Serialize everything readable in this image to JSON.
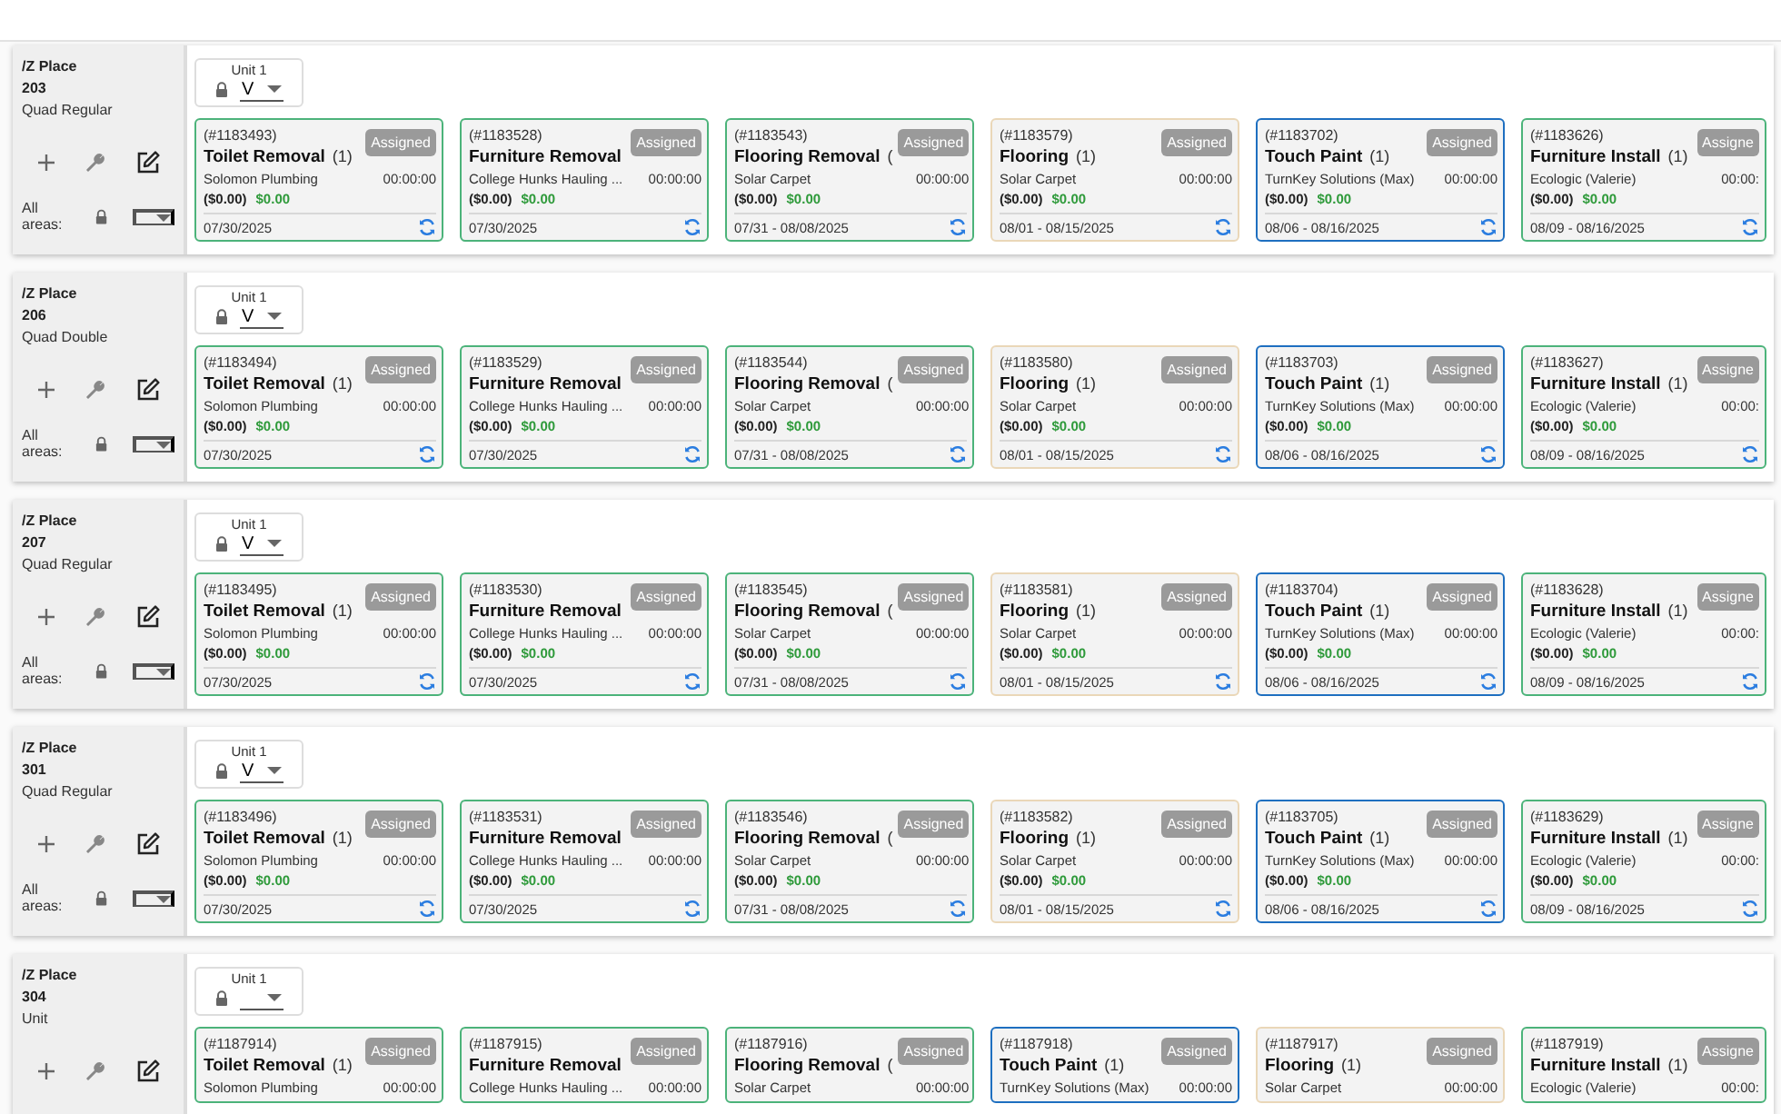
{
  "rows": [
    {
      "place": "/Z Place",
      "number": "203",
      "type": "Quad Regular",
      "all_areas_label": "All areas:",
      "unit": {
        "label": "Unit 1",
        "value": "V"
      },
      "cards": [
        {
          "id": "(#1183493)",
          "title": "Toilet Removal",
          "count": "(1)",
          "company": "Solomon Plumbing",
          "status": "Assigned",
          "timer": "00:00:00",
          "cost": "($0.00)",
          "paid": "$0.00",
          "dates": "07/30/2025",
          "color": "#4cb37a"
        },
        {
          "id": "(#1183528)",
          "title": "Furniture Removal",
          "company": "College Hunks Hauling ...",
          "status": "Assigned",
          "timer": "00:00:00",
          "cost": "($0.00)",
          "paid": "$0.00",
          "dates": "07/30/2025",
          "color": "#4cb37a"
        },
        {
          "id": "(#1183543)",
          "title": "Flooring Removal",
          "count": "(",
          "company": "Solar Carpet",
          "status": "Assigned",
          "timer": "00:00:00",
          "cost": "($0.00)",
          "paid": "$0.00",
          "dates": "07/31 - 08/08/2025",
          "color": "#4cb37a"
        },
        {
          "id": "(#1183579)",
          "title": "Flooring",
          "count": "(1)",
          "company": "Solar Carpet",
          "status": "Assigned",
          "timer": "00:00:00",
          "cost": "($0.00)",
          "paid": "$0.00",
          "dates": "08/01 - 08/15/2025",
          "color": "#ead7b8"
        },
        {
          "id": "(#1183702)",
          "title": "Touch Paint",
          "count": "(1)",
          "company": "TurnKey Solutions (Max)",
          "status": "Assigned",
          "timer": "00:00:00",
          "cost": "($0.00)",
          "paid": "$0.00",
          "dates": "08/06 - 08/16/2025",
          "color": "#1e6fc0"
        },
        {
          "id": "(#1183626)",
          "title": "Furniture Install",
          "count": "(1)",
          "company": "Ecologic (Valerie)",
          "status": "Assigne",
          "timer": "00:00:",
          "cost": "($0.00)",
          "paid": "$0.00",
          "dates": "08/09 - 08/16/2025",
          "color": "#4cb37a"
        }
      ]
    },
    {
      "place": "/Z Place",
      "number": "206",
      "type": "Quad Double",
      "all_areas_label": "All areas:",
      "unit": {
        "label": "Unit 1",
        "value": "V"
      },
      "cards": [
        {
          "id": "(#1183494)",
          "title": "Toilet Removal",
          "count": "(1)",
          "company": "Solomon Plumbing",
          "status": "Assigned",
          "timer": "00:00:00",
          "cost": "($0.00)",
          "paid": "$0.00",
          "dates": "07/30/2025",
          "color": "#4cb37a"
        },
        {
          "id": "(#1183529)",
          "title": "Furniture Removal",
          "company": "College Hunks Hauling ...",
          "status": "Assigned",
          "timer": "00:00:00",
          "cost": "($0.00)",
          "paid": "$0.00",
          "dates": "07/30/2025",
          "color": "#4cb37a"
        },
        {
          "id": "(#1183544)",
          "title": "Flooring Removal",
          "count": "(",
          "company": "Solar Carpet",
          "status": "Assigned",
          "timer": "00:00:00",
          "cost": "($0.00)",
          "paid": "$0.00",
          "dates": "07/31 - 08/08/2025",
          "color": "#4cb37a"
        },
        {
          "id": "(#1183580)",
          "title": "Flooring",
          "count": "(1)",
          "company": "Solar Carpet",
          "status": "Assigned",
          "timer": "00:00:00",
          "cost": "($0.00)",
          "paid": "$0.00",
          "dates": "08/01 - 08/15/2025",
          "color": "#ead7b8"
        },
        {
          "id": "(#1183703)",
          "title": "Touch Paint",
          "count": "(1)",
          "company": "TurnKey Solutions (Max)",
          "status": "Assigned",
          "timer": "00:00:00",
          "cost": "($0.00)",
          "paid": "$0.00",
          "dates": "08/06 - 08/16/2025",
          "color": "#1e6fc0"
        },
        {
          "id": "(#1183627)",
          "title": "Furniture Install",
          "count": "(1)",
          "company": "Ecologic (Valerie)",
          "status": "Assigne",
          "timer": "00:00:",
          "cost": "($0.00)",
          "paid": "$0.00",
          "dates": "08/09 - 08/16/2025",
          "color": "#4cb37a"
        }
      ]
    },
    {
      "place": "/Z Place",
      "number": "207",
      "type": "Quad Regular",
      "all_areas_label": "All areas:",
      "unit": {
        "label": "Unit 1",
        "value": "V"
      },
      "cards": [
        {
          "id": "(#1183495)",
          "title": "Toilet Removal",
          "count": "(1)",
          "company": "Solomon Plumbing",
          "status": "Assigned",
          "timer": "00:00:00",
          "cost": "($0.00)",
          "paid": "$0.00",
          "dates": "07/30/2025",
          "color": "#4cb37a"
        },
        {
          "id": "(#1183530)",
          "title": "Furniture Removal",
          "company": "College Hunks Hauling ...",
          "status": "Assigned",
          "timer": "00:00:00",
          "cost": "($0.00)",
          "paid": "$0.00",
          "dates": "07/30/2025",
          "color": "#4cb37a"
        },
        {
          "id": "(#1183545)",
          "title": "Flooring Removal",
          "count": "(",
          "company": "Solar Carpet",
          "status": "Assigned",
          "timer": "00:00:00",
          "cost": "($0.00)",
          "paid": "$0.00",
          "dates": "07/31 - 08/08/2025",
          "color": "#4cb37a"
        },
        {
          "id": "(#1183581)",
          "title": "Flooring",
          "count": "(1)",
          "company": "Solar Carpet",
          "status": "Assigned",
          "timer": "00:00:00",
          "cost": "($0.00)",
          "paid": "$0.00",
          "dates": "08/01 - 08/15/2025",
          "color": "#ead7b8"
        },
        {
          "id": "(#1183704)",
          "title": "Touch Paint",
          "count": "(1)",
          "company": "TurnKey Solutions (Max)",
          "status": "Assigned",
          "timer": "00:00:00",
          "cost": "($0.00)",
          "paid": "$0.00",
          "dates": "08/06 - 08/16/2025",
          "color": "#1e6fc0"
        },
        {
          "id": "(#1183628)",
          "title": "Furniture Install",
          "count": "(1)",
          "company": "Ecologic (Valerie)",
          "status": "Assigne",
          "timer": "00:00:",
          "cost": "($0.00)",
          "paid": "$0.00",
          "dates": "08/09 - 08/16/2025",
          "color": "#4cb37a"
        }
      ]
    },
    {
      "place": "/Z Place",
      "number": "301",
      "type": "Quad Regular",
      "all_areas_label": "All areas:",
      "unit": {
        "label": "Unit 1",
        "value": "V"
      },
      "cards": [
        {
          "id": "(#1183496)",
          "title": "Toilet Removal",
          "count": "(1)",
          "company": "Solomon Plumbing",
          "status": "Assigned",
          "timer": "00:00:00",
          "cost": "($0.00)",
          "paid": "$0.00",
          "dates": "07/30/2025",
          "color": "#4cb37a"
        },
        {
          "id": "(#1183531)",
          "title": "Furniture Removal",
          "company": "College Hunks Hauling ...",
          "status": "Assigned",
          "timer": "00:00:00",
          "cost": "($0.00)",
          "paid": "$0.00",
          "dates": "07/30/2025",
          "color": "#4cb37a"
        },
        {
          "id": "(#1183546)",
          "title": "Flooring Removal",
          "count": "(",
          "company": "Solar Carpet",
          "status": "Assigned",
          "timer": "00:00:00",
          "cost": "($0.00)",
          "paid": "$0.00",
          "dates": "07/31 - 08/08/2025",
          "color": "#4cb37a"
        },
        {
          "id": "(#1183582)",
          "title": "Flooring",
          "count": "(1)",
          "company": "Solar Carpet",
          "status": "Assigned",
          "timer": "00:00:00",
          "cost": "($0.00)",
          "paid": "$0.00",
          "dates": "08/01 - 08/15/2025",
          "color": "#ead7b8"
        },
        {
          "id": "(#1183705)",
          "title": "Touch Paint",
          "count": "(1)",
          "company": "TurnKey Solutions (Max)",
          "status": "Assigned",
          "timer": "00:00:00",
          "cost": "($0.00)",
          "paid": "$0.00",
          "dates": "08/06 - 08/16/2025",
          "color": "#1e6fc0"
        },
        {
          "id": "(#1183629)",
          "title": "Furniture Install",
          "count": "(1)",
          "company": "Ecologic (Valerie)",
          "status": "Assigne",
          "timer": "00:00:",
          "cost": "($0.00)",
          "paid": "$0.00",
          "dates": "08/09 - 08/16/2025",
          "color": "#4cb37a"
        }
      ]
    },
    {
      "place": "/Z Place",
      "number": "304",
      "type": "Unit",
      "unit": {
        "label": "Unit 1"
      },
      "cards": [
        {
          "id": "(#1187914)",
          "title": "Toilet Removal",
          "count": "(1)",
          "company": "Solomon Plumbing",
          "status": "Assigned",
          "timer": "00:00:00",
          "color": "#4cb37a"
        },
        {
          "id": "(#1187915)",
          "title": "Furniture Removal",
          "company": "College Hunks Hauling ...",
          "status": "Assigned",
          "timer": "00:00:00",
          "color": "#4cb37a"
        },
        {
          "id": "(#1187916)",
          "title": "Flooring Removal",
          "count": "(",
          "company": "Solar Carpet",
          "status": "Assigned",
          "timer": "00:00:00",
          "color": "#4cb37a"
        },
        {
          "id": "(#1187918)",
          "title": "Touch Paint",
          "count": "(1)",
          "company": "TurnKey Solutions (Max)",
          "status": "Assigned",
          "timer": "00:00:00",
          "color": "#1e6fc0"
        },
        {
          "id": "(#1187917)",
          "title": "Flooring",
          "count": "(1)",
          "company": "Solar Carpet",
          "status": "Assigned",
          "timer": "00:00:00",
          "color": "#ead7b8"
        },
        {
          "id": "(#1187919)",
          "title": "Furniture Install",
          "count": "(1)",
          "company": "Ecologic (Valerie)",
          "status": "Assigne",
          "timer": "00:00:",
          "color": "#4cb37a"
        }
      ]
    }
  ]
}
